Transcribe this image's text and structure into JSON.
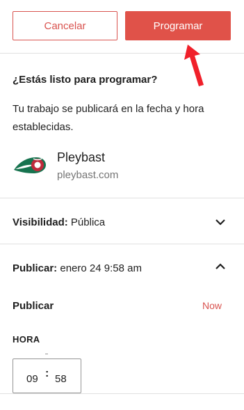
{
  "actions": {
    "cancel_label": "Cancelar",
    "primary_label": "Programar"
  },
  "ready": {
    "title": "¿Estás listo para programar?",
    "description": "Tu trabajo se publicará en la fecha y hora establecidas."
  },
  "site": {
    "name": "Pleybast",
    "url": "pleybast.com",
    "logo_icon": "pleybast-logo-icon"
  },
  "visibility": {
    "label": "Visibilidad:",
    "value": "Pública"
  },
  "publish": {
    "label": "Publicar:",
    "value": "enero 24 9:58 am",
    "sub_label": "Publicar",
    "now_label": "Now",
    "time_label": "HORA",
    "hours": "09",
    "separator": ":",
    "minutes": "58"
  },
  "colors": {
    "accent": "#e05249",
    "accent_text": "#d9534f",
    "arrow": "#f0202a"
  }
}
